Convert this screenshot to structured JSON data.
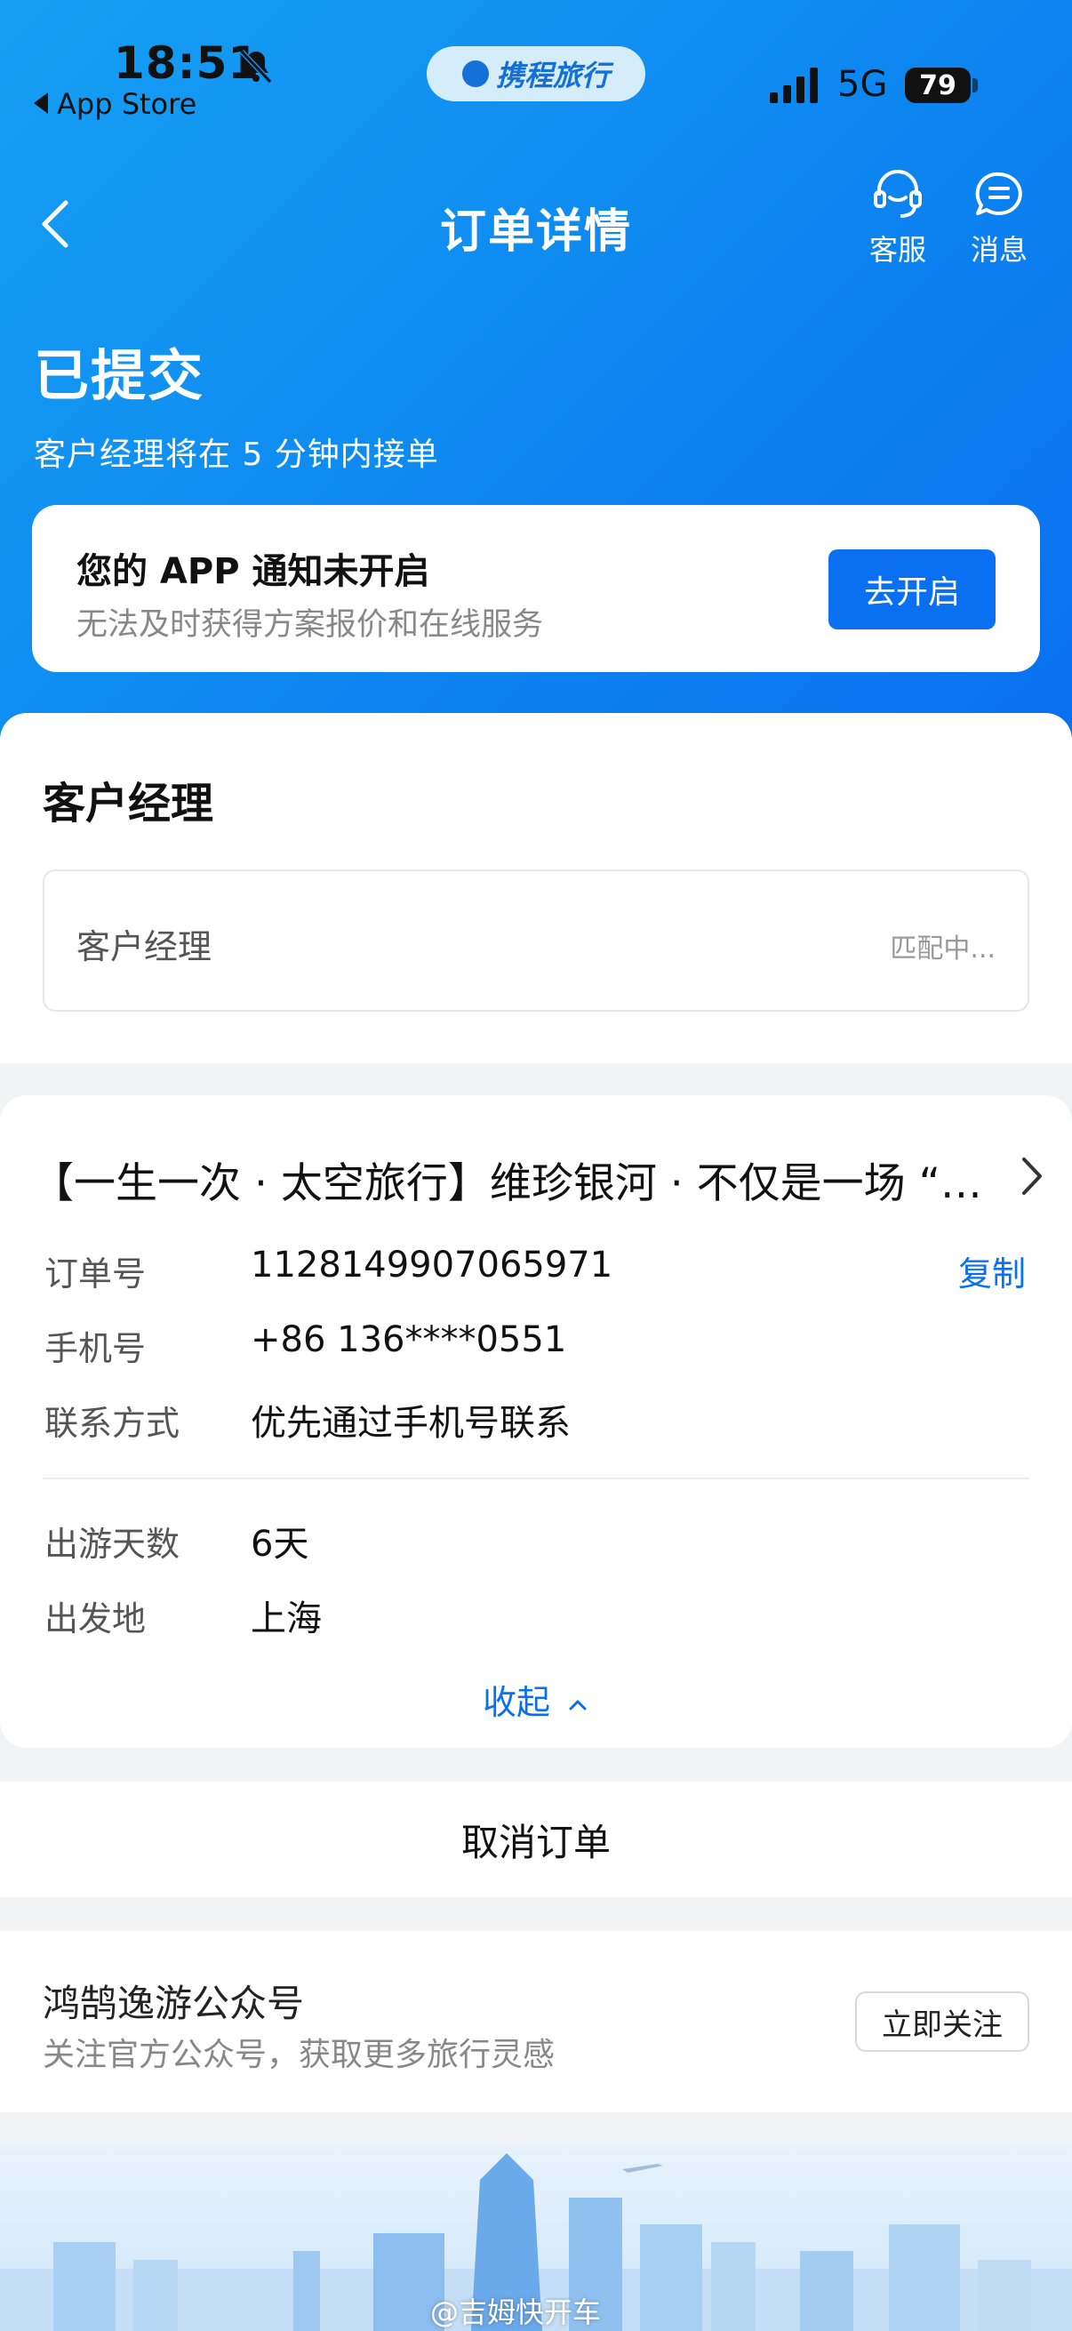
{
  "status_bar": {
    "time": "18:51",
    "back_app": "App Store",
    "brand": "携程旅行",
    "network": "5G",
    "battery": "79"
  },
  "nav": {
    "title": "订单详情",
    "service_label": "客服",
    "message_label": "消息"
  },
  "order_state": {
    "title": "已提交",
    "subtitle": "客户经理将在 5 分钟内接单"
  },
  "notice": {
    "title": "您的 APP 通知未开启",
    "subtitle": "无法及时获得方案报价和在线服务",
    "button": "去开启"
  },
  "manager": {
    "heading": "客户经理",
    "label": "客户经理",
    "status": "匹配中..."
  },
  "order": {
    "title": "【一生一次 · 太空旅行】维珍银河 · 不仅是一场 “…",
    "rows": [
      {
        "label": "订单号",
        "value": "1128149907065971"
      },
      {
        "label": "手机号",
        "value": "+86 136****0551"
      },
      {
        "label": "联系方式",
        "value": "优先通过手机号联系"
      },
      {
        "label": "出游天数",
        "value": "6天"
      },
      {
        "label": "出发地",
        "value": "上海"
      }
    ],
    "copy_label": "复制",
    "collapse_label": "收起"
  },
  "cancel": {
    "label": "取消订单"
  },
  "follow": {
    "name": "鸿鹄逸游公众号",
    "subtitle": "关注官方公众号，获取更多旅行灵感",
    "button": "立即关注"
  },
  "watermark": "@吉姆快开车",
  "colors": {
    "accent": "#0a6ff0",
    "hero_start": "#16a0f3",
    "hero_end": "#0a6ff0"
  }
}
